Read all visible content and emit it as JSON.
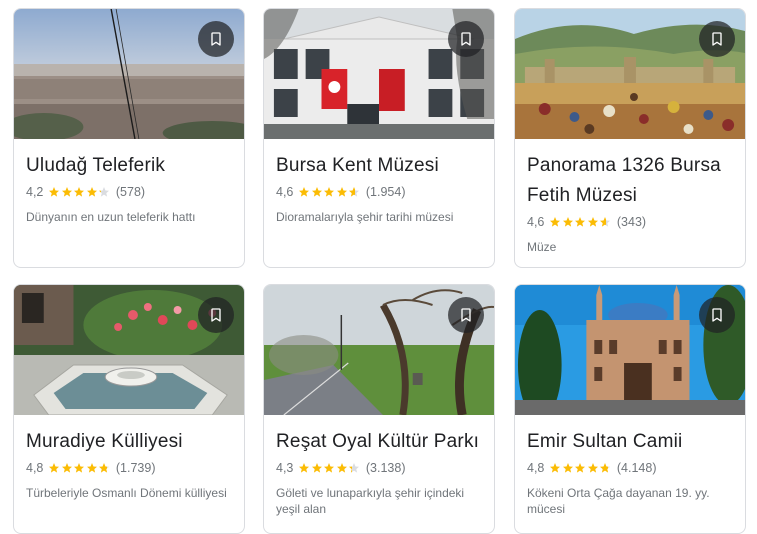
{
  "cards": [
    {
      "title": "Uludağ Teleferik",
      "rating": "4,2",
      "rating_value": 4.2,
      "reviews": "(578)",
      "description": "Dünyanın en uzun teleferik hattı",
      "save_icon": "bookmark-icon"
    },
    {
      "title": "Bursa Kent Müzesi",
      "rating": "4,6",
      "rating_value": 4.6,
      "reviews": "(1.954)",
      "description": "Dioramalarıyla şehir tarihi müzesi",
      "save_icon": "bookmark-icon"
    },
    {
      "title": "Panorama 1326 Bursa Fetih Müzesi",
      "rating": "4,6",
      "rating_value": 4.6,
      "reviews": "(343)",
      "description": "Müze",
      "save_icon": "bookmark-icon"
    },
    {
      "title": "Muradiye Külliyesi",
      "rating": "4,8",
      "rating_value": 4.8,
      "reviews": "(1.739)",
      "description": "Türbeleriyle Osmanlı Dönemi külliyesi",
      "save_icon": "bookmark-icon"
    },
    {
      "title": "Reşat Oyal Kültür Parkı",
      "rating": "4,3",
      "rating_value": 4.3,
      "reviews": "(3.138)",
      "description": "Göleti ve lunaparkıyla şehir içindeki yeşil alan",
      "save_icon": "bookmark-icon"
    },
    {
      "title": "Emir Sultan Camii",
      "rating": "4,8",
      "rating_value": 4.8,
      "reviews": "(4.148)",
      "description": "Kökeni Orta Çağa dayanan 19. yy. mücesi",
      "save_icon": "bookmark-icon"
    }
  ],
  "colors": {
    "star": "#fbbc04",
    "star_empty": "#dadce0",
    "text_secondary": "#70757a"
  }
}
